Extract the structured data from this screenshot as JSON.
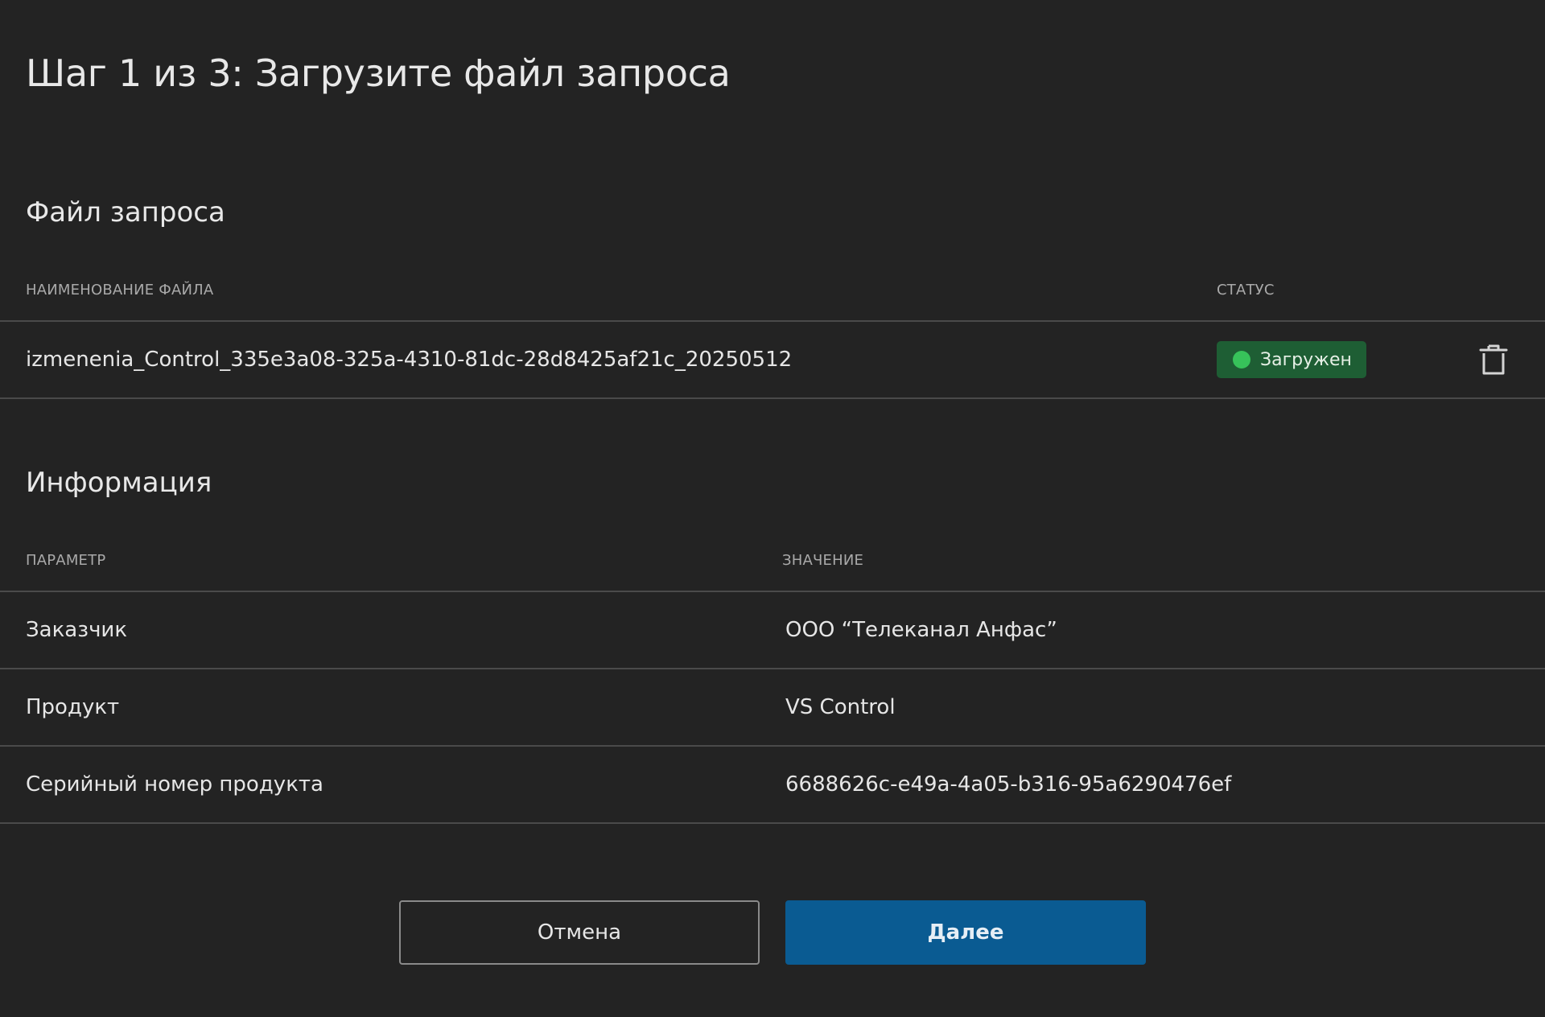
{
  "page": {
    "title": "Шаг 1 из 3: Загрузите файл запроса"
  },
  "file_section": {
    "title": "Файл запроса",
    "columns": {
      "name": "НАИМЕНОВАНИЕ ФАЙЛА",
      "status": "СТАТУС"
    },
    "rows": [
      {
        "file_name": "izmenenia_Control_335e3a08-325a-4310-81dc-28d8425af21c_20250512",
        "status": "Загружен",
        "status_color": "#37c25a",
        "delete_icon": "trash-icon"
      }
    ]
  },
  "info_section": {
    "title": "Информация",
    "columns": {
      "parameter": "ПАРАМЕТР",
      "value": "ЗНАЧЕНИЕ"
    },
    "rows": [
      {
        "parameter": "Заказчик",
        "value": "ООО “Телеканал Анфас”"
      },
      {
        "parameter": "Продукт",
        "value": "VS Control"
      },
      {
        "parameter": "Серийный номер продукта",
        "value": "6688626c-e49a-4a05-b316-95a6290476ef"
      }
    ]
  },
  "actions": {
    "cancel_label": "Отмена",
    "next_label": "Далее"
  },
  "colors": {
    "background": "#232323",
    "primary": "#0a5b92",
    "success_badge": "#1e5e34"
  }
}
